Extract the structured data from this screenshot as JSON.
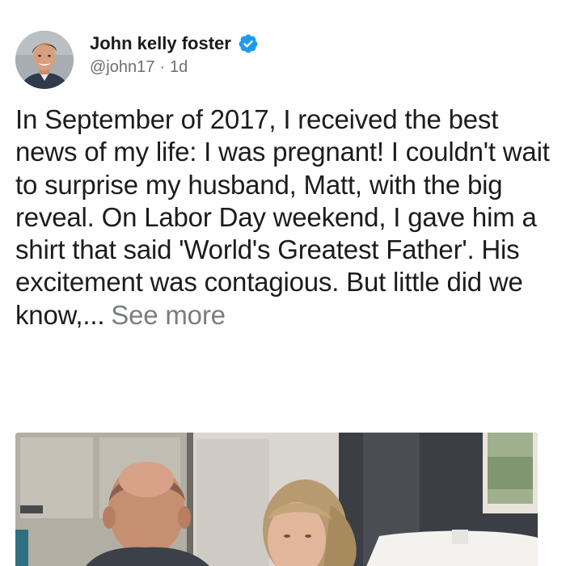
{
  "post": {
    "author": {
      "display_name": "John kelly foster",
      "handle": "@john17",
      "time_ago": "1d",
      "verified": true
    },
    "separator": "·",
    "text": "In September of 2017, I received the best news of my life: I was pregnant! I couldn't wait to surprise my husband, Matt, with the big reveal. On Labor Day weekend, I gave him a shirt that said 'World's Greatest Father'. His excitement was contagious. But little did we know,...",
    "see_more_label": "See more",
    "media": {
      "kind": "photo"
    }
  },
  "colors": {
    "verified_badge": "#1d9bf0",
    "meta_text": "#6c6f73",
    "see_more": "#7a7d80",
    "body_text": "#1c1c1c"
  }
}
